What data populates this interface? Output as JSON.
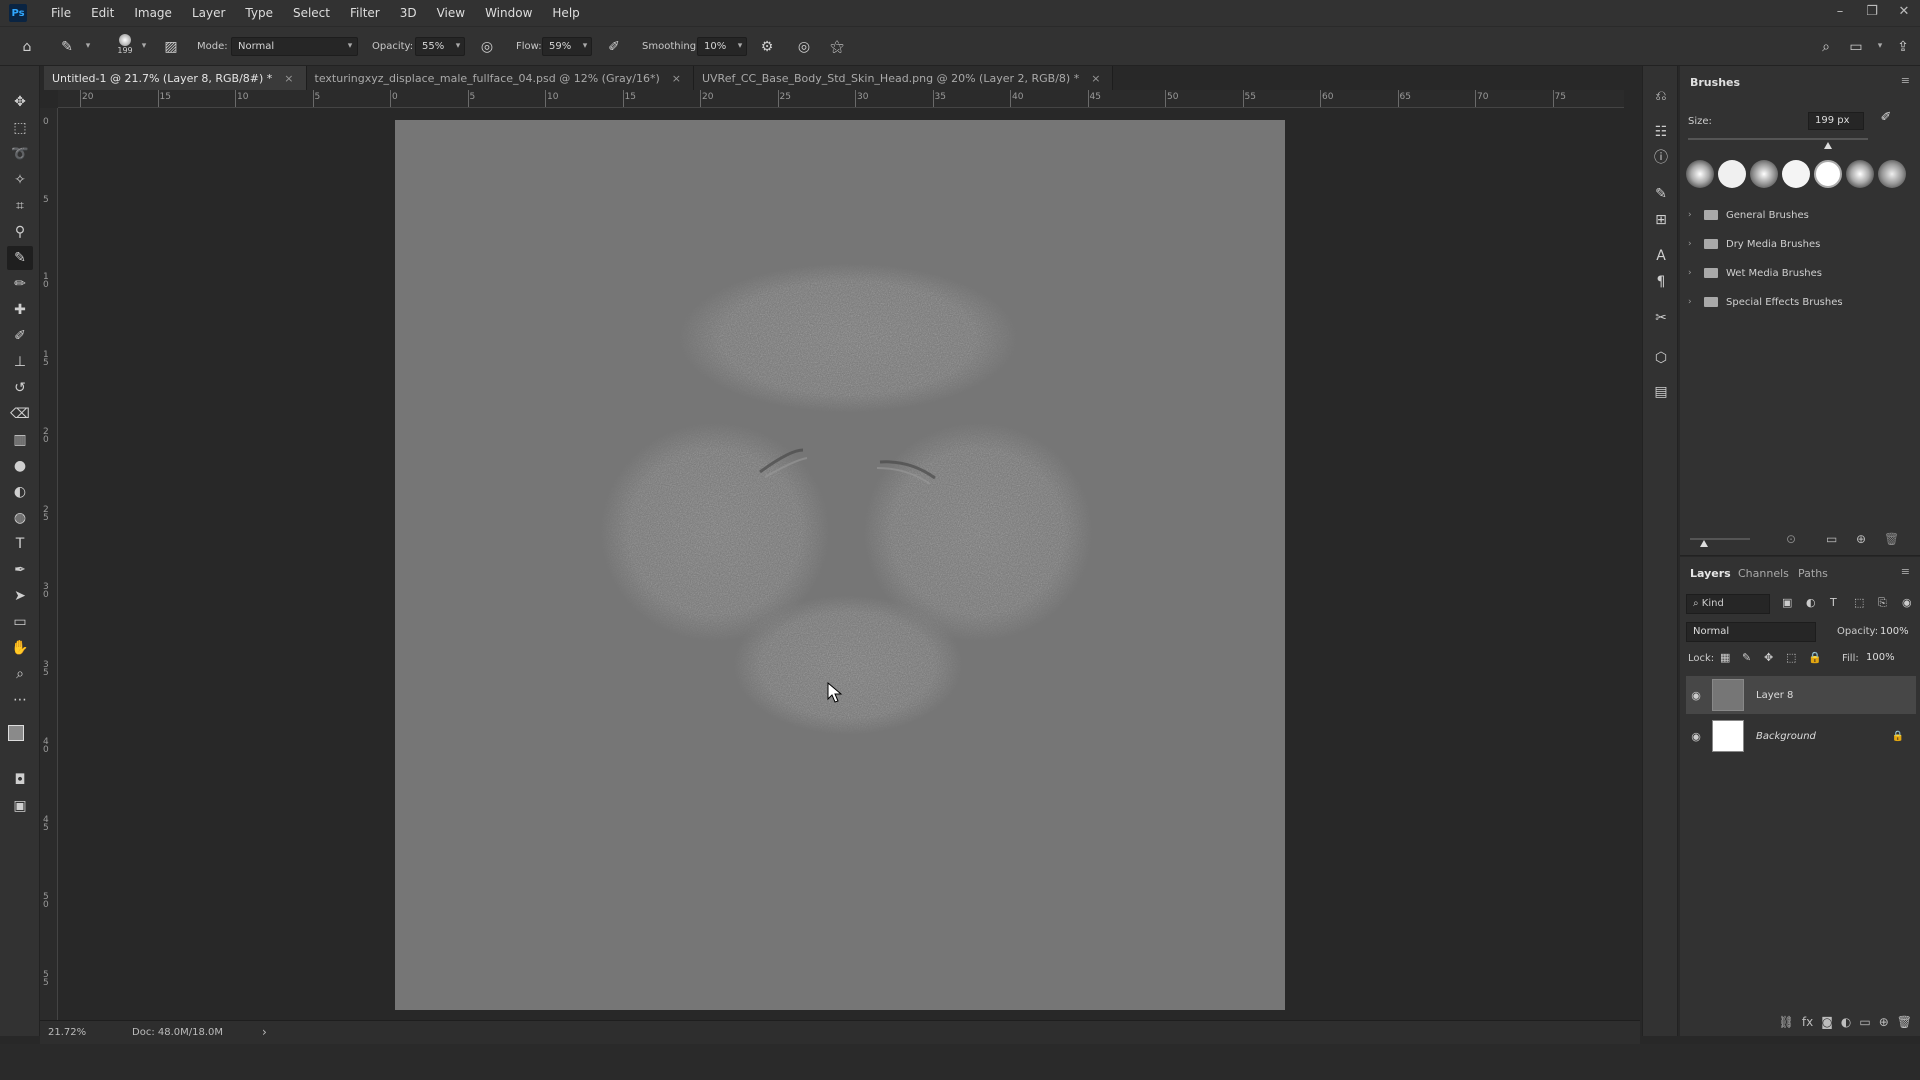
{
  "app": {
    "logo_text": "Ps",
    "menu": [
      "File",
      "Edit",
      "Image",
      "Layer",
      "Type",
      "Select",
      "Filter",
      "3D",
      "View",
      "Window",
      "Help"
    ],
    "window_controls": {
      "minimize": "–",
      "restore": "❐",
      "close": "✕"
    }
  },
  "options_bar": {
    "brush_size_value": "199",
    "mode_label": "Mode:",
    "mode_value": "Normal",
    "opacity_label": "Opacity:",
    "opacity_value": "55%",
    "flow_label": "Flow:",
    "flow_value": "59%",
    "smoothing_label": "Smoothing:",
    "smoothing_value": "10%"
  },
  "tabs": [
    {
      "label": "Untitled-1 @ 21.7% (Layer 8, RGB/8#) *",
      "active": true
    },
    {
      "label": "texturingxyz_displace_male_fullface_04.psd @ 12% (Gray/16*)",
      "active": false
    },
    {
      "label": "UVRef_CC_Base_Body_Std_Skin_Head.png @ 20% (Layer 2, RGB/8) *",
      "active": false
    }
  ],
  "tab_close_glyph": "×",
  "ruler_top": [
    "20",
    "15",
    "10",
    "5",
    "0",
    "5",
    "10",
    "15",
    "20",
    "25",
    "30",
    "35",
    "40",
    "45",
    "50",
    "55",
    "60",
    "65",
    "70",
    "75"
  ],
  "ruler_left": [
    "0",
    "5",
    "1 0",
    "1 5",
    "2 0",
    "2 5",
    "3 0",
    "3 5",
    "4 0",
    "4 5",
    "5 0",
    "5 5"
  ],
  "status": {
    "zoom": "21.72%",
    "doc": "Doc: 48.0M/18.0M",
    "arrow": "›"
  },
  "brushes_panel": {
    "title": "Brushes",
    "size_label": "Size:",
    "size_value": "199 px",
    "size_fraction": 0.78,
    "groups": [
      "General Brushes",
      "Dry Media Brushes",
      "Wet Media Brushes",
      "Special Effects Brushes"
    ]
  },
  "layers_panel": {
    "tabs": [
      "Layers",
      "Channels",
      "Paths"
    ],
    "kind_label": "Kind",
    "blend_mode": "Normal",
    "opacity_label": "Opacity:",
    "opacity_value": "100%",
    "lock_label": "Lock:",
    "fill_label": "Fill:",
    "fill_value": "100%",
    "layers": [
      {
        "name": "Layer 8",
        "selected": true,
        "thumb_color": "#767676"
      },
      {
        "name": "Background",
        "selected": false,
        "thumb_color": "#ffffff",
        "locked": true
      }
    ]
  },
  "colors": {
    "canvas": "#767676",
    "panel_bg": "#323232",
    "workspace_bg": "#282828",
    "accent": "#31a8ff"
  }
}
